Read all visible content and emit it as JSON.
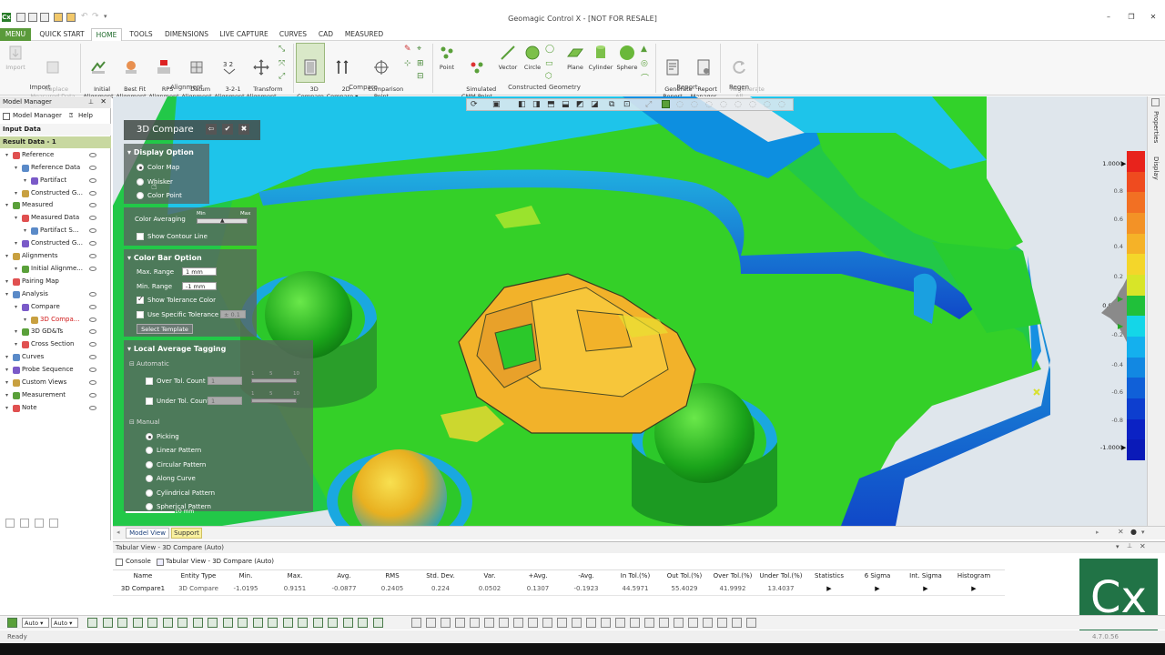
{
  "window": {
    "title": "Geomagic Control X - [NOT FOR RESALE]",
    "app_badge": "Cx"
  },
  "tabs": [
    "MENU",
    "QUICK START",
    "HOME",
    "TOOLS",
    "DIMENSIONS",
    "LIVE CAPTURE",
    "CURVES",
    "CAD",
    "MEASURED"
  ],
  "ribbon": {
    "import": {
      "buttons": [
        "Import",
        "Replace\nMeasured Data"
      ],
      "group": "Import"
    },
    "alignment": {
      "buttons": [
        "Initial\nAlignment",
        "Best Fit\nAlignment",
        "RPS\nAlignment",
        "Datum\nAlignment",
        "3-2-1\nAlignment",
        "Transform\nAlignment"
      ],
      "group": "Alignment"
    },
    "compare": {
      "buttons": [
        "3D\nCompare",
        "2D\nCompare ▾",
        "Comparison\nPoint"
      ],
      "group": "Compare"
    },
    "geometry": {
      "buttons": [
        "Point",
        "Simulated\nCMM Point",
        "Vector",
        "Circle",
        "Plane",
        "Cylinder",
        "Sphere"
      ],
      "group": "Constructed Geometry"
    },
    "report": {
      "buttons": [
        "Generate\nReport",
        "Report\nManager"
      ],
      "group": "Report"
    },
    "regen": {
      "buttons": [
        "Regenerate\nAll"
      ],
      "group": "Regen"
    }
  },
  "left_panel": {
    "title": "Model Manager",
    "tabs": [
      "Model Manager",
      "Help"
    ],
    "tree": [
      {
        "label": "Input Data",
        "type": "header"
      },
      {
        "label": "Result Data - 1",
        "type": "header-selected"
      },
      {
        "label": "Reference",
        "indent": 1
      },
      {
        "label": "Reference Data",
        "indent": 2
      },
      {
        "label": "Partifact",
        "indent": 3
      },
      {
        "label": "Constructed G...",
        "indent": 2
      },
      {
        "label": "Measured",
        "indent": 1
      },
      {
        "label": "Measured Data",
        "indent": 2
      },
      {
        "label": "Partifact S...",
        "indent": 3
      },
      {
        "label": "Constructed G...",
        "indent": 2
      },
      {
        "label": "Alignments",
        "indent": 1
      },
      {
        "label": "Initial Alignme...",
        "indent": 2
      },
      {
        "label": "Pairing Map",
        "indent": 1
      },
      {
        "label": "Analysis",
        "indent": 1
      },
      {
        "label": "Compare",
        "indent": 2
      },
      {
        "label": "3D Compa...",
        "indent": 3,
        "highlight": true
      },
      {
        "label": "3D GD&Ts",
        "indent": 2
      },
      {
        "label": "Cross Section",
        "indent": 2
      },
      {
        "label": "Curves",
        "indent": 1
      },
      {
        "label": "Probe Sequence",
        "indent": 1
      },
      {
        "label": "Custom Views",
        "indent": 1
      },
      {
        "label": "Measurement",
        "indent": 1
      },
      {
        "label": "Note",
        "indent": 1
      }
    ]
  },
  "compare_panel": {
    "title": "3D Compare",
    "display_option": {
      "header": "Display Option",
      "options": [
        "Color Map",
        "Whisker",
        "Color Point"
      ],
      "selected": 0,
      "color_averaging": "Color Averaging",
      "slider_min": "Min",
      "slider_max": "Max",
      "show_contour": "Show Contour Line"
    },
    "color_bar_option": {
      "header": "Color Bar Option",
      "max_label": "Max. Range",
      "max_value": "1 mm",
      "min_label": "Min. Range",
      "min_value": "-1 mm",
      "show_tolerance": "Show Tolerance Color",
      "use_specific": "Use Specific Tolerance",
      "specific_value": "± 0.1",
      "template_btn": "Select Template"
    },
    "local_avg": {
      "header": "Local Average Tagging",
      "automatic": "Automatic",
      "over_tol": "Over Tol. Count",
      "under_tol": "Under Tol. Count",
      "count_value": "1",
      "slider_ticks": [
        "1",
        "5",
        "10"
      ],
      "manual": "Manual",
      "manual_options": [
        "Picking",
        "Linear Pattern",
        "Circular Pattern",
        "Along Curve",
        "Cylindrical Pattern",
        "Spherical Pattern"
      ],
      "manual_selected": 0,
      "scale": "10 mm"
    }
  },
  "color_bar": {
    "labels": [
      "1.0000",
      "0.8",
      "0.6",
      "0.4",
      "0.0000",
      "-0.4",
      "-0.6",
      "-0.8",
      "-1.0000"
    ],
    "extra_labels": [
      "0.2",
      "-0.2"
    ],
    "colors_top_to_bottom": [
      "#e8231c",
      "#ef4b1f",
      "#f27023",
      "#f39226",
      "#f5b228",
      "#f4d62a",
      "#d8e528",
      "#20c03a",
      "#14d6e8",
      "#14b0ee",
      "#1288e2",
      "#1060d8",
      "#0d3ecf",
      "#0b22c4",
      "#0a1ab8"
    ]
  },
  "right_strip": {
    "tabs": [
      "Properties",
      "Display"
    ]
  },
  "view_tabs": [
    "Model View",
    "Support"
  ],
  "tabular": {
    "title": "Tabular View - 3D Compare (Auto)",
    "tabs": [
      "Console",
      "Tabular View - 3D Compare (Auto)"
    ],
    "columns": [
      "Name",
      "Entity Type",
      "Min.",
      "Max.",
      "Avg.",
      "RMS",
      "Std. Dev.",
      "Var.",
      "+Avg.",
      "-Avg.",
      "In Tol.(%)",
      "Out Tol.(%)",
      "Over Tol.(%)",
      "Under Tol.(%)",
      "Statistics",
      "6 Sigma",
      "Int. Sigma",
      "Histogram"
    ],
    "rows": [
      [
        "3D Compare1",
        "3D Compare",
        "-1.0195",
        "0.9151",
        "-0.0877",
        "0.2405",
        "0.224",
        "0.0502",
        "0.1307",
        "-0.1923",
        "44.5971",
        "55.4029",
        "41.9992",
        "13.4037",
        "▶",
        "▶",
        "▶",
        "▶"
      ]
    ]
  },
  "bottom_toolbar": {
    "dropdown1": "Auto",
    "dropdown2": "Auto"
  },
  "status": {
    "text": "Ready",
    "version": "4.7.0.56"
  }
}
